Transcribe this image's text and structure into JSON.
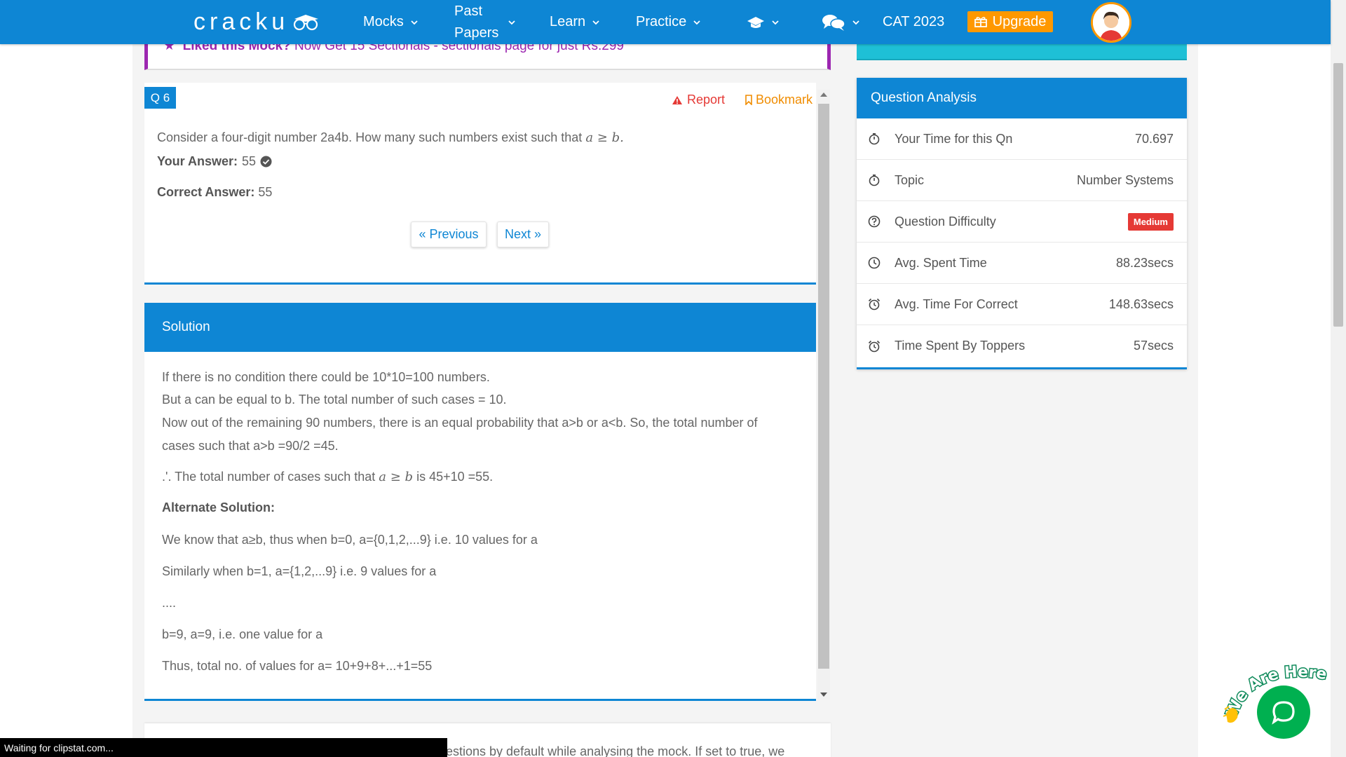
{
  "nav": {
    "logo": "cracku",
    "items": [
      {
        "label": "Mocks"
      },
      {
        "label_line1": "Past",
        "label_line2": "Papers"
      },
      {
        "label": "Learn"
      },
      {
        "label": "Practice"
      }
    ],
    "cat": "CAT 2023",
    "upgrade": "Upgrade"
  },
  "banner": {
    "bold": "Liked this Mock?",
    "text": "Now Get 15 Sectionals - sectionals page for just Rs.299"
  },
  "question": {
    "badge": "Q 6",
    "report": "Report",
    "bookmark": "Bookmark",
    "text": "Consider a four-digit number 2a4b. How many such numbers exist such that",
    "math": "a ≥ b",
    "your_answer_label": "Your Answer:",
    "your_answer": "55",
    "correct_answer_label": "Correct Answer:",
    "correct_answer": "55",
    "prev": "« Previous",
    "next": "Next »"
  },
  "solution": {
    "title": "Solution",
    "lines": [
      "If there is no condition there could be 10*10=100 numbers.",
      "But a can be equal to b. The total number of such cases = 10.",
      "Now out of the remaining 90 numbers, there is an equal probability that a>b or a<b. So, the total number of",
      "cases such that a>b =90/2 =45.",
      ".'. The total number of cases such that",
      "is 45+10 =55.",
      "Alternate Solution:",
      "We know that a≥b, thus when b=0, a={0,1,2,...9} i.e. 10 values for a",
      "Similarly when b=1, a={1,2,...9} i.e. 9 values for a",
      "....",
      "b=9, a=9, i.e. one value for a",
      "Thus, total no. of values for a= 10+9+8+...+1=55"
    ],
    "math": "a ≥ b"
  },
  "bottom_text": "estions by default while analysing the mock. If set to true, we",
  "status": "Waiting for clipstat.com...",
  "analysis": {
    "title": "Question Analysis",
    "rows": [
      {
        "label": "Your Time for this Qn",
        "value": "70.697",
        "icon": "stopwatch-icon"
      },
      {
        "label": "Topic",
        "value": "Number Systems",
        "icon": "stopwatch-icon"
      },
      {
        "label": "Question Difficulty",
        "value": "Medium",
        "icon": "question-circle-icon"
      },
      {
        "label": "Avg. Spent Time",
        "value": "88.23secs",
        "icon": "clock-icon"
      },
      {
        "label": "Avg. Time For Correct",
        "value": "148.63secs",
        "icon": "alarm-icon"
      },
      {
        "label": "Time Spent By Toppers",
        "value": "57secs",
        "icon": "alarm-icon"
      }
    ]
  },
  "chat_label": "We Are Here!",
  "colors": {
    "primary": "#0e86d4",
    "accent": "#ff9800",
    "danger": "#e53935",
    "purple": "#9c27b0",
    "cyan": "#1ec0d6",
    "chat": "#00b050"
  }
}
